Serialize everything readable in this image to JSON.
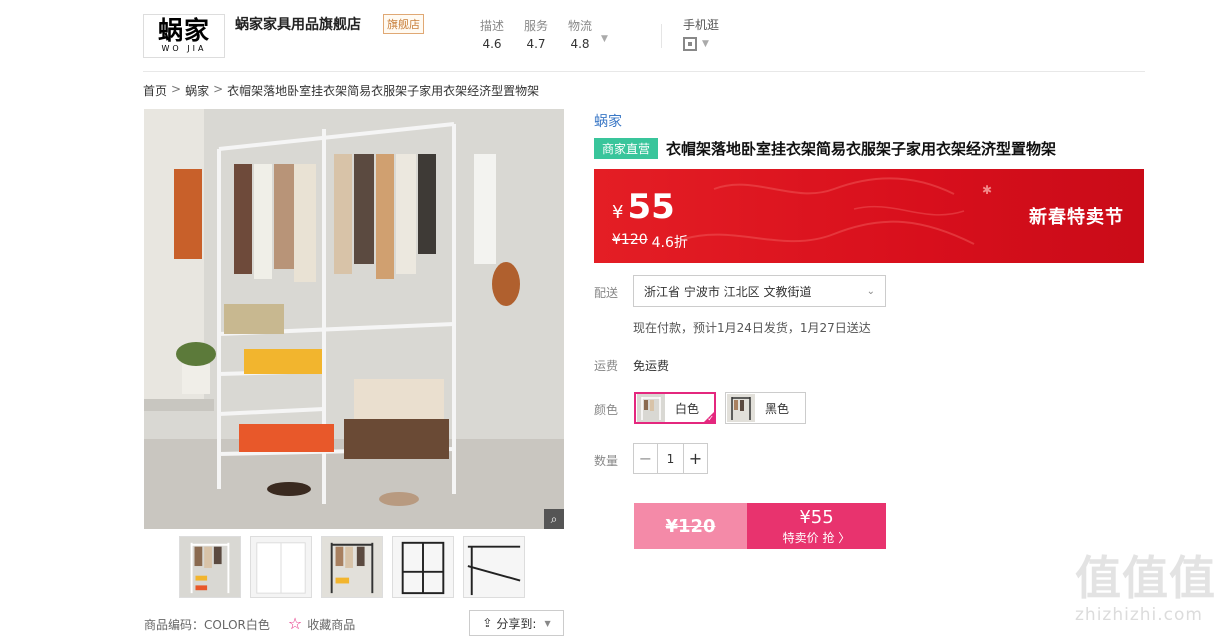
{
  "header": {
    "logo_main": "蜗家",
    "logo_sub": "WO  JIA",
    "shop_name": "蜗家家具用品旗舰店",
    "shop_badge": "旗舰店",
    "scores": [
      {
        "label": "描述",
        "value": "4.6"
      },
      {
        "label": "服务",
        "value": "4.7"
      },
      {
        "label": "物流",
        "value": "4.8"
      }
    ],
    "mobile_label": "手机逛"
  },
  "breadcrumb": [
    "首页",
    "蜗家",
    "衣帽架落地卧室挂衣架简易衣服架子家用衣架经济型置物架"
  ],
  "breadcrumb_sep": ">",
  "product": {
    "brand": "蜗家",
    "tag": "商家直营",
    "title": "衣帽架落地卧室挂衣架简易衣服架子家用衣架经济型置物架",
    "price_symbol": "¥",
    "price_now": "55",
    "price_old": "¥120",
    "discount": "4.6折",
    "festival": "新春特卖节"
  },
  "delivery": {
    "label": "配送",
    "address": "浙江省 宁波市 江北区 文教街道",
    "note": "现在付款，预计1月24日发货，1月27日送达"
  },
  "shipping": {
    "label": "运费",
    "value": "免运费"
  },
  "color": {
    "label": "颜色",
    "options": [
      {
        "name": "白色",
        "selected": true
      },
      {
        "name": "黑色",
        "selected": false
      }
    ]
  },
  "quantity": {
    "label": "数量",
    "value": "1",
    "minus": "−",
    "plus": "+"
  },
  "buy": {
    "orig_price": "¥120",
    "now_price": "¥55",
    "cta": "特卖价 抢 〉"
  },
  "bottom": {
    "code": "商品编码：COLOR白色",
    "favorite": "收藏商品",
    "share": "分享到:"
  },
  "watermark": {
    "logo": "值值值",
    "url": "zhizhizhi.com"
  },
  "colors": {
    "accent_pink": "#e4277e",
    "brand_red": "#e41e25",
    "direct_green": "#39c59b",
    "link_blue": "#3b78c6"
  }
}
